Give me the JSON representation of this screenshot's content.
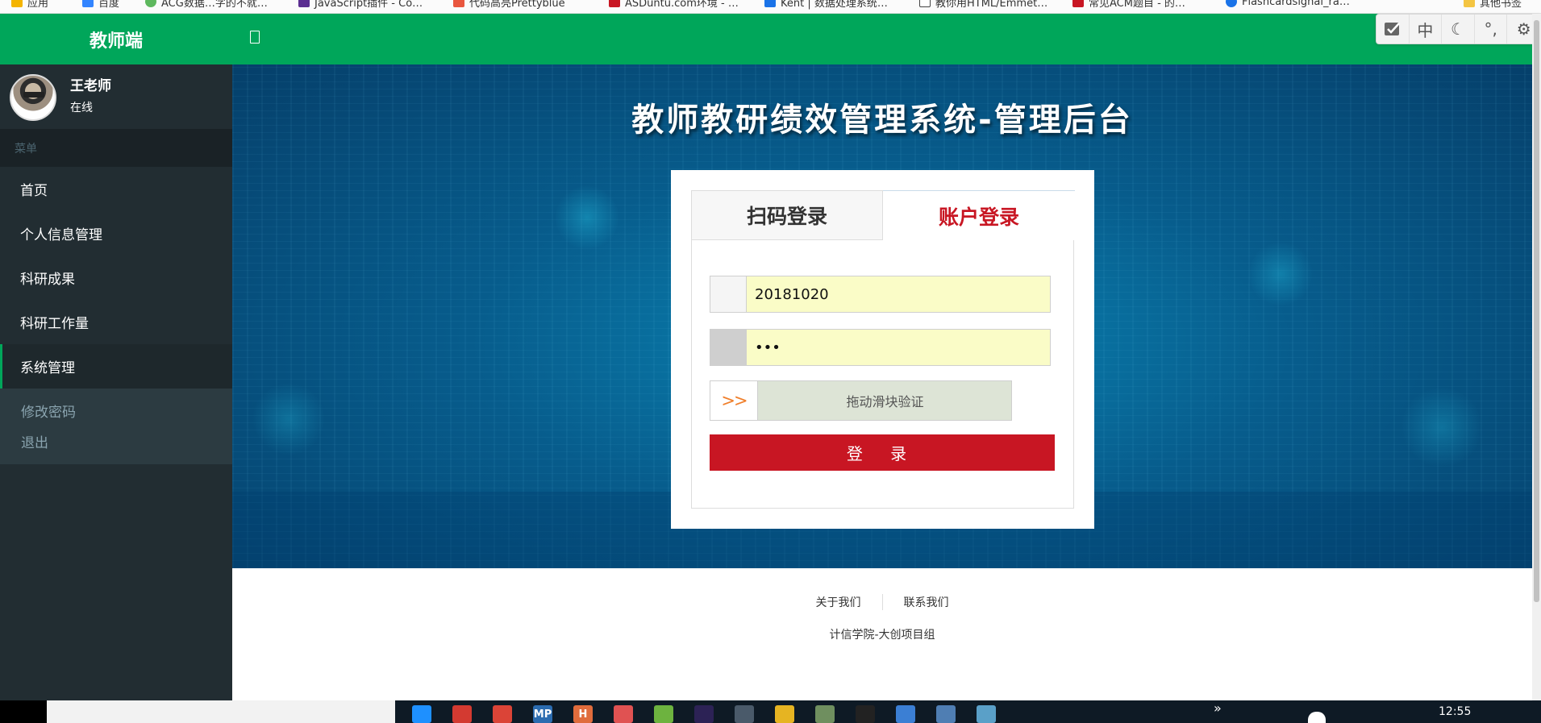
{
  "browser": {
    "bookmarks": [
      {
        "label": "应用",
        "color": "#f4b400"
      },
      {
        "label": "百度",
        "color": "#3385ff"
      },
      {
        "label": "ACG数据…字的不就…",
        "color": "#5eb85e"
      },
      {
        "label": "JavaScript插件 - Co…",
        "color": "#5b2e91"
      },
      {
        "label": "代码高亮Prettyblue",
        "color": "#e9573f"
      },
      {
        "label": "ASDuntu.com环境 - …",
        "color": "#c81623"
      },
      {
        "label": "Kent | 数据处理系统…",
        "color": "#1a73e8"
      },
      {
        "label": "教你用HTML/Emmet…",
        "color": "#444444"
      },
      {
        "label": "常见ACM题目 - 的…",
        "color": "#c81623"
      },
      {
        "label": "Flashcardsignal_ra…",
        "color": "#1a73e8"
      },
      {
        "label": "其他书签",
        "color": "#f4c542"
      }
    ]
  },
  "sidebar": {
    "brand": "教师端",
    "user": {
      "name": "王老师",
      "status": "在线"
    },
    "menu_header": "菜单",
    "items": [
      {
        "label": "首页"
      },
      {
        "label": "个人信息管理"
      },
      {
        "label": "科研成果"
      },
      {
        "label": "科研工作量"
      },
      {
        "label": "系统管理"
      }
    ],
    "active_item": "系统管理",
    "subitems": [
      {
        "label": "修改密码"
      },
      {
        "label": "退出"
      }
    ]
  },
  "header": {
    "toggle_icon": "sidebar-toggle-icon",
    "ime_toolbar": [
      "check",
      "中",
      "moon",
      "punctuation",
      "gear"
    ]
  },
  "hero": {
    "title": "教师教研绩效管理系统-管理后台"
  },
  "login": {
    "tabs": [
      {
        "label": "扫码登录",
        "active": false
      },
      {
        "label": "账户登录",
        "active": true
      }
    ],
    "username_value": "20181020",
    "password_value": "•••",
    "slider_handle": ">>",
    "slider_text": "拖动滑块验证",
    "submit_label": "登 录",
    "accent_color": "#c81623"
  },
  "footer": {
    "links": [
      "关于我们",
      "联系我们"
    ],
    "org": "计信学院-大创项目组"
  },
  "taskbar": {
    "chevron": "»",
    "clock": "12:55",
    "apps": [
      {
        "name": "task-view-icon",
        "label": "",
        "color": "#1e90ff"
      },
      {
        "name": "netease-music-icon",
        "label": "",
        "color": "#d33a31"
      },
      {
        "name": "chrome-icon",
        "label": "",
        "color": "#db4437"
      },
      {
        "name": "mp-icon",
        "label": "MP",
        "color": "#2b6cb0"
      },
      {
        "name": "hbuilder-icon",
        "label": "H",
        "color": "#e06c3c"
      },
      {
        "name": "eraser-icon",
        "label": "",
        "color": "#e05252"
      },
      {
        "name": "spring-icon",
        "label": "",
        "color": "#6db33f"
      },
      {
        "name": "eclipse-icon",
        "label": "",
        "color": "#2c2255"
      },
      {
        "name": "settings-icon",
        "label": "",
        "color": "#4a5a6a"
      },
      {
        "name": "files-icon",
        "label": "",
        "color": "#e6b422"
      },
      {
        "name": "photo-icon",
        "label": "",
        "color": "#6f8f5f"
      },
      {
        "name": "terminal-icon",
        "label": "",
        "color": "#222222"
      },
      {
        "name": "window-icon",
        "label": "",
        "color": "#3b7fd4"
      },
      {
        "name": "mysql-icon",
        "label": "",
        "color": "#4f7eb3"
      },
      {
        "name": "pen-icon",
        "label": "",
        "color": "#5aa0c8"
      }
    ]
  }
}
